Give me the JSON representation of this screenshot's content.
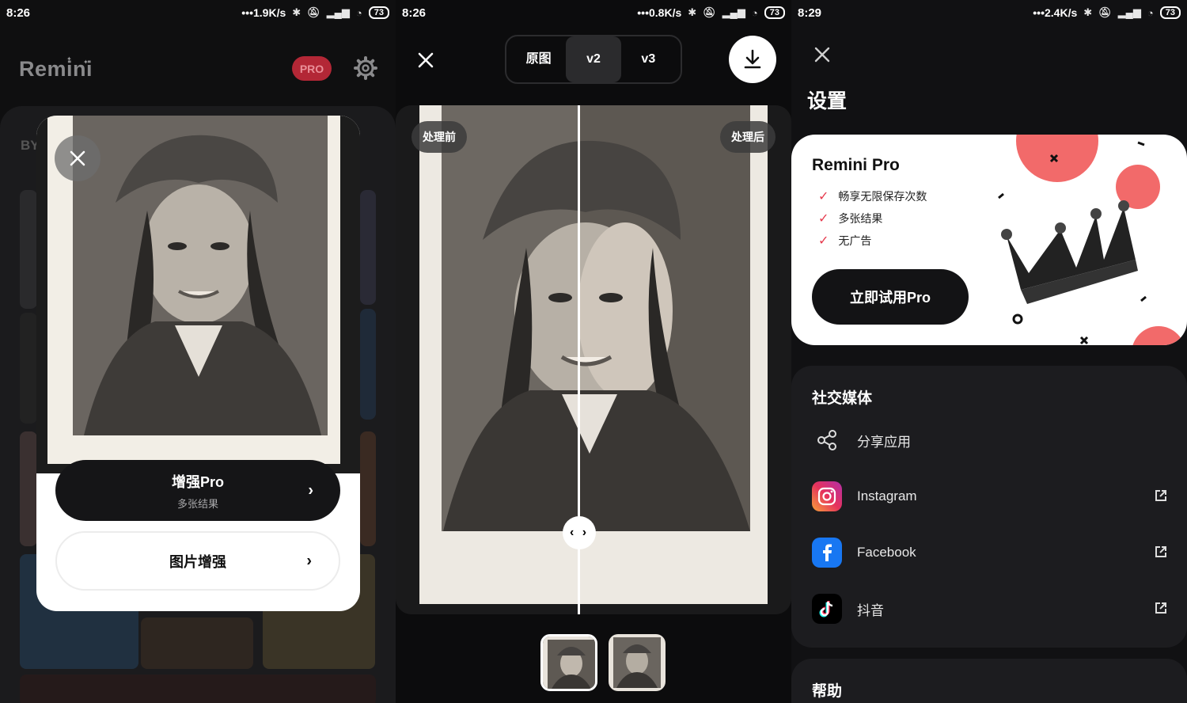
{
  "colors": {
    "accent_red": "#e63a4d",
    "pro_pill": "#b32736",
    "dark_button": "#151517"
  },
  "panel1": {
    "status": {
      "time": "8:26",
      "speed": "1.9K/s",
      "battery": "73"
    },
    "app_logo": "Remini",
    "pro_badge": "PRO",
    "bg_label": "BY",
    "modal": {
      "enhance_pro": {
        "title": "增强Pro",
        "subtitle": "多张结果"
      },
      "enhance": {
        "title": "图片增强"
      }
    }
  },
  "panel2": {
    "status": {
      "time": "8:26",
      "speed": "0.8K/s",
      "battery": "73"
    },
    "segments": [
      "原图",
      "v2",
      "v3"
    ],
    "selected_segment": "v2",
    "before_label": "处理前",
    "after_label": "处理后",
    "handle_glyph": "‹ ›"
  },
  "panel3": {
    "status": {
      "time": "8:29",
      "speed": "2.4K/s",
      "battery": "73"
    },
    "title": "设置",
    "pro_card": {
      "title": "Remini Pro",
      "features": [
        "畅享无限保存次数",
        "多张结果",
        "无广告"
      ],
      "button": "立即试用Pro"
    },
    "social": {
      "title": "社交媒体",
      "items": [
        {
          "label": "分享应用",
          "icon": "share-icon"
        },
        {
          "label": "Instagram",
          "icon": "instagram-icon"
        },
        {
          "label": "Facebook",
          "icon": "facebook-icon"
        },
        {
          "label": "抖音",
          "icon": "tiktok-icon"
        }
      ]
    },
    "help_title": "帮助"
  }
}
